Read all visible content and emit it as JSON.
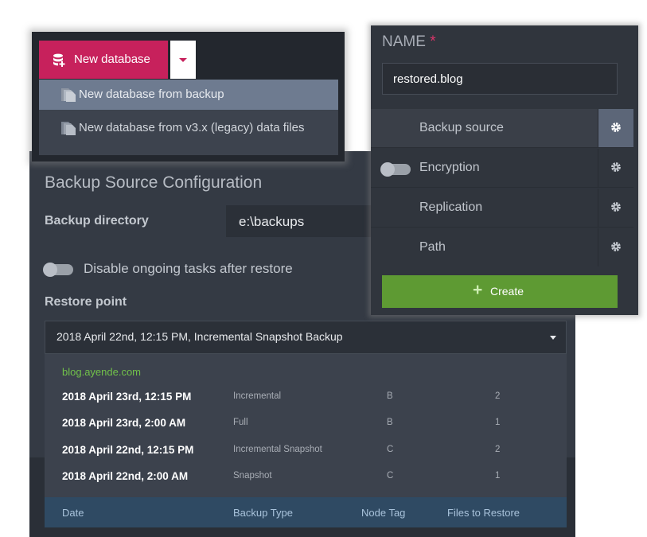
{
  "menu": {
    "new_database_label": "New database",
    "items": [
      {
        "label": "New database from backup",
        "icon": "file-stack-icon"
      },
      {
        "label": "New database from v3.x (legacy) data files",
        "icon": "file-stack-icon"
      }
    ]
  },
  "config": {
    "title": "Backup Source Configuration",
    "backup_directory_label": "Backup directory",
    "backup_directory_value": "e:\\backups",
    "disable_tasks_label": "Disable ongoing tasks after restore",
    "restore_point_label": "Restore point",
    "restore_point_selected": "2018 April 22nd, 12:15 PM, Incremental Snapshot Backup",
    "dropdown": {
      "group": "blog.ayende.com",
      "rows": [
        {
          "date": "2018 April 23rd, 12:15 PM",
          "type": "Incremental",
          "node": "B",
          "files": "2"
        },
        {
          "date": "2018 April 23rd, 2:00 AM",
          "type": "Full",
          "node": "B",
          "files": "1"
        },
        {
          "date": "2018 April 22nd, 12:15 PM",
          "type": "Incremental Snapshot",
          "node": "C",
          "files": "2"
        },
        {
          "date": "2018 April 22nd, 2:00 AM",
          "type": "Snapshot",
          "node": "C",
          "files": "1"
        }
      ],
      "headers": {
        "date": "Date",
        "type": "Backup Type",
        "node": "Node Tag",
        "files": "Files to Restore"
      }
    }
  },
  "panel": {
    "name_label": "NAME",
    "required_mark": "*",
    "name_value": "restored.blog",
    "options": [
      {
        "label": "Backup source",
        "active": true
      },
      {
        "label": "Encryption",
        "toggle": true
      },
      {
        "label": "Replication"
      },
      {
        "label": "Path"
      }
    ],
    "create_label": "Create",
    "create_icon": "plus-icon"
  },
  "colors": {
    "accent": "#c7215c",
    "create_green": "#5e9a33",
    "group_green": "#71c04a",
    "panel_bg": "#30353d"
  }
}
